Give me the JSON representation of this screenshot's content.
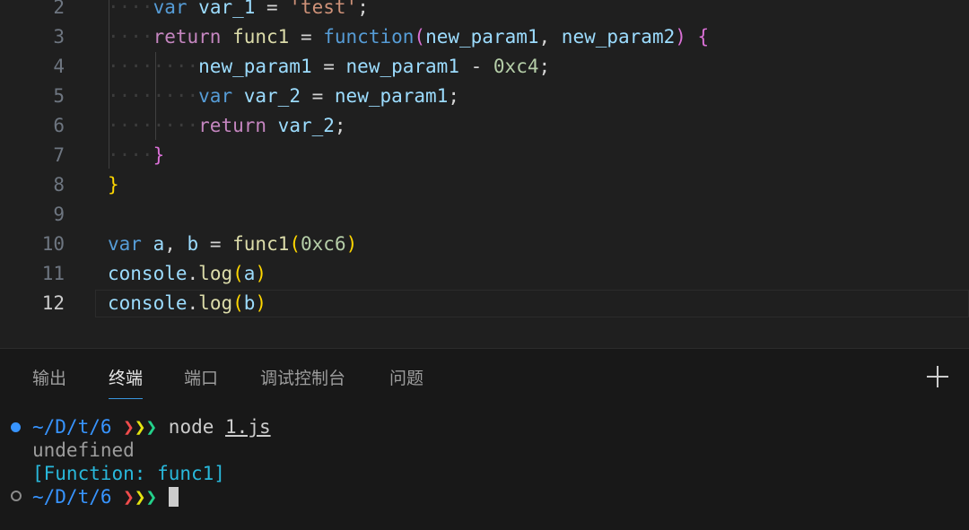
{
  "editor": {
    "lines": [
      {
        "n": "2",
        "tokens": [
          [
            "ws",
            "····"
          ],
          [
            "kw",
            "var"
          ],
          [
            "op",
            " "
          ],
          [
            "var",
            "var_1"
          ],
          [
            "op",
            " = "
          ],
          [
            "str",
            "'test'"
          ],
          [
            "op",
            ";"
          ]
        ]
      },
      {
        "n": "3",
        "tokens": [
          [
            "ws",
            "····"
          ],
          [
            "ctl",
            "return"
          ],
          [
            "op",
            " "
          ],
          [
            "fn",
            "func1"
          ],
          [
            "op",
            " = "
          ],
          [
            "kw",
            "function"
          ],
          [
            "b2",
            "("
          ],
          [
            "var",
            "new_param1"
          ],
          [
            "op",
            ", "
          ],
          [
            "var",
            "new_param2"
          ],
          [
            "b2",
            ")"
          ],
          [
            "op",
            " "
          ],
          [
            "b2",
            "{"
          ]
        ]
      },
      {
        "n": "4",
        "tokens": [
          [
            "ws",
            "········"
          ],
          [
            "var",
            "new_param1"
          ],
          [
            "op",
            " = "
          ],
          [
            "var",
            "new_param1"
          ],
          [
            "op",
            " - "
          ],
          [
            "num",
            "0xc4"
          ],
          [
            "op",
            ";"
          ]
        ]
      },
      {
        "n": "5",
        "tokens": [
          [
            "ws",
            "········"
          ],
          [
            "kw",
            "var"
          ],
          [
            "op",
            " "
          ],
          [
            "var",
            "var_2"
          ],
          [
            "op",
            " = "
          ],
          [
            "var",
            "new_param1"
          ],
          [
            "op",
            ";"
          ]
        ]
      },
      {
        "n": "6",
        "tokens": [
          [
            "ws",
            "········"
          ],
          [
            "ctl",
            "return"
          ],
          [
            "op",
            " "
          ],
          [
            "var",
            "var_2"
          ],
          [
            "op",
            ";"
          ]
        ]
      },
      {
        "n": "7",
        "tokens": [
          [
            "ws",
            "····"
          ],
          [
            "b2",
            "}"
          ]
        ]
      },
      {
        "n": "8",
        "tokens": [
          [
            "b1",
            "}"
          ]
        ]
      },
      {
        "n": "9",
        "tokens": []
      },
      {
        "n": "10",
        "tokens": [
          [
            "kw",
            "var"
          ],
          [
            "op",
            " "
          ],
          [
            "var",
            "a"
          ],
          [
            "op",
            ", "
          ],
          [
            "var",
            "b"
          ],
          [
            "op",
            " = "
          ],
          [
            "fn",
            "func1"
          ],
          [
            "b1",
            "("
          ],
          [
            "num",
            "0xc6"
          ],
          [
            "b1",
            ")"
          ]
        ]
      },
      {
        "n": "11",
        "tokens": [
          [
            "var",
            "console"
          ],
          [
            "op",
            "."
          ],
          [
            "fn",
            "log"
          ],
          [
            "b1",
            "("
          ],
          [
            "var",
            "a"
          ],
          [
            "b1",
            ")"
          ]
        ]
      },
      {
        "n": "12",
        "tokens": [
          [
            "var",
            "console"
          ],
          [
            "op",
            "."
          ],
          [
            "fn",
            "log"
          ],
          [
            "b1",
            "("
          ],
          [
            "var",
            "b"
          ],
          [
            "b1",
            ")"
          ]
        ]
      }
    ],
    "active_line": "12"
  },
  "panel": {
    "tabs": [
      "输出",
      "终端",
      "端口",
      "调试控制台",
      "问题"
    ],
    "active_tab": "终端",
    "add_icon": "plus-icon"
  },
  "terminal": {
    "prompt_path": "~/D/t/6",
    "prompt_arrows": [
      "❯",
      "❯",
      "❯"
    ],
    "command": "node",
    "command_arg": "1.js",
    "output": [
      "undefined",
      "[Function: func1]"
    ]
  },
  "colors": {
    "keyword": "#569cd6",
    "control": "#c586c0",
    "variable": "#9cdcfe",
    "function": "#dcdcaa",
    "string": "#ce9178",
    "number": "#b5cea8",
    "accent": "#3794ff"
  }
}
